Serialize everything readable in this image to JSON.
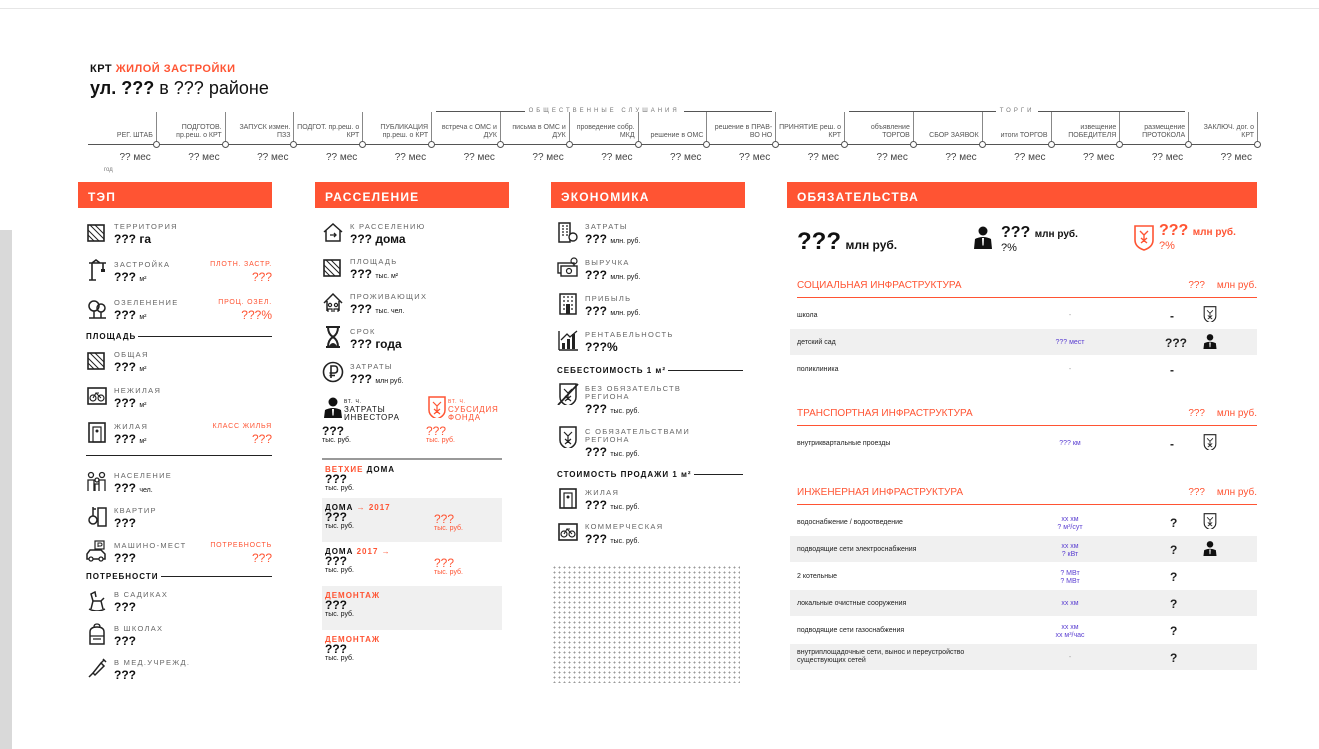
{
  "header": {
    "prefix": "КРТ",
    "title_red": "ЖИЛОЙ ЗАСТРОЙКИ",
    "street_bold": "ул. ???",
    "street_rest": "в ??? районе"
  },
  "timeline": {
    "groups": [
      {
        "label": "ОБЩЕСТВЕННЫЕ СЛУШАНИЯ"
      },
      {
        "label": "ТОРГИ"
      }
    ],
    "stages": [
      {
        "label": "РЕГ. ШТАБ",
        "mes": "?? мес"
      },
      {
        "label": "ПОДГОТОВ. пр.реш. о КРТ",
        "mes": "?? мес"
      },
      {
        "label": "ЗАПУСК измен. ПЗЗ",
        "mes": "?? мес"
      },
      {
        "label": "ПОДГОТ. пр.реш. о КРТ",
        "mes": "?? мес"
      },
      {
        "label": "ПУБЛИКАЦИЯ пр.реш. о КРТ",
        "mes": "?? мес"
      },
      {
        "label": "встреча с ОМС и ДУК",
        "mes": "?? мес"
      },
      {
        "label": "письма в ОМС и ДУК",
        "mes": "?? мес"
      },
      {
        "label": "проведение собр. МКД",
        "mes": "?? мес"
      },
      {
        "label": "решение в ОМС",
        "mes": "?? мес"
      },
      {
        "label": "решение в ПРАВ-ВО НО",
        "mes": "?? мес"
      },
      {
        "label": "ПРИНЯТИЕ реш. о КРТ",
        "mes": "?? мес"
      },
      {
        "label": "объявление ТОРГОВ",
        "mes": "?? мес"
      },
      {
        "label": "СБОР ЗАЯВОК",
        "mes": "?? мес"
      },
      {
        "label": "итоги ТОРГОВ",
        "mes": "?? мес"
      },
      {
        "label": "извещение ПОБЕДИТЕЛЯ",
        "mes": "?? мес"
      },
      {
        "label": "размещение ПРОТОКОЛА",
        "mes": "?? мес"
      },
      {
        "label": "ЗАКЛЮЧ. дог. о КРТ",
        "mes": "?? мес"
      }
    ],
    "first_sub": "год"
  },
  "tep": {
    "title": "ТЭП",
    "items": [
      {
        "label": "ТЕРРИТОРИЯ",
        "value": "??? га",
        "unit": "",
        "icon": "territory-icon"
      },
      {
        "label": "ЗАСТРОЙКА",
        "value": "???",
        "unit": "м²",
        "icon": "crane-icon",
        "right_label": "ПЛОТН. ЗАСТР.",
        "right_value": "???"
      },
      {
        "label": "ОЗЕЛЕНЕНИЕ",
        "value": "???",
        "unit": "м²",
        "icon": "tree-icon",
        "right_label": "ПРОЦ. ОЗЕЛ.",
        "right_value": "???%"
      }
    ],
    "area_title": "ПЛОЩАДЬ",
    "area_items": [
      {
        "label": "ОБЩАЯ",
        "value": "???",
        "unit": "м²",
        "icon": "area-icon"
      },
      {
        "label": "НЕЖИЛАЯ",
        "value": "???",
        "unit": "м²",
        "icon": "bike-icon"
      },
      {
        "label": "ЖИЛАЯ",
        "value": "???",
        "unit": "м²",
        "icon": "door-icon",
        "right_label": "КЛАСС ЖИЛЬЯ",
        "right_value": "???"
      }
    ],
    "pop_items": [
      {
        "label": "НАСЕЛЕНИЕ",
        "value": "???",
        "unit": "чел.",
        "icon": "family-icon"
      },
      {
        "label": "КВАРТИР",
        "value": "???",
        "unit": "",
        "icon": "keys-icon"
      },
      {
        "label": "МАШИНО-МЕСТ",
        "value": "???",
        "unit": "",
        "icon": "parking-icon",
        "right_label": "ПОТРЕБНОСТЬ",
        "right_value": "???"
      }
    ],
    "needs_title": "ПОТРЕБНОСТИ",
    "needs_items": [
      {
        "label": "В САДИКАХ",
        "value": "???",
        "icon": "rocking-horse-icon"
      },
      {
        "label": "В ШКОЛАХ",
        "value": "???",
        "icon": "backpack-icon"
      },
      {
        "label": "В МЕД.УЧРЕЖД.",
        "value": "???",
        "icon": "syringe-icon"
      }
    ]
  },
  "rass": {
    "title": "РАССЕЛЕНИЕ",
    "items": [
      {
        "label": "К РАССЕЛЕНИЮ",
        "value": "??? дома",
        "icon": "relocation-icon"
      },
      {
        "label": "ПЛОЩАДЬ",
        "value": "???",
        "unit": "тыс. м²",
        "icon": "area-icon"
      },
      {
        "label": "ПРОЖИВАЮЩИХ",
        "value": "???",
        "unit": "тыс. чел.",
        "icon": "residents-icon"
      },
      {
        "label": "СРОК",
        "value": "??? года",
        "icon": "hourglass-icon"
      },
      {
        "label": "ЗАТРАТЫ",
        "value": "???",
        "unit": "млн руб.",
        "icon": "ruble-icon"
      }
    ],
    "inv_label_small": "ВТ. Ч.",
    "inv_label": "ЗАТРАТЫ ИНВЕСТОРА",
    "inv_value": "???",
    "inv_unit": "тыс. руб.",
    "fund_label_small": "ВТ. Ч.",
    "fund_label": "СУБСИДИЯ ФОНДА",
    "fund_value": "???",
    "fund_unit": "тыс. руб.",
    "blocks": [
      {
        "t1": "ВЕТХИЕ",
        "t2": " ДОМА",
        "v": "???",
        "u": "тыс. руб.",
        "gray": false
      },
      {
        "t1": "ДОМА",
        "t2": " → 2017",
        "v": "???",
        "u": "тыс. руб.",
        "rv": "???",
        "ru": "тыс. руб.",
        "gray": true
      },
      {
        "t1": "ДОМА",
        "t2": " 2017 →",
        "v": "???",
        "u": "тыс. руб.",
        "rv": "???",
        "ru": "тыс. руб.",
        "gray": false
      },
      {
        "t1": "ДЕМОНТАЖ",
        "t2": "",
        "v": "???",
        "u": "тыс. руб.",
        "gray": true
      },
      {
        "t1": "ДЕМОНТАЖ",
        "t2": "",
        "v": "???",
        "u": "тыс. руб.",
        "gray": false
      }
    ]
  },
  "econ": {
    "title": "ЭКОНОМИКА",
    "items": [
      {
        "label": "ЗАТРАТЫ",
        "value": "???",
        "unit": "млн. руб.",
        "icon": "building-cost-icon"
      },
      {
        "label": "ВЫРУЧКА",
        "value": "???",
        "unit": "млн. руб.",
        "icon": "money-icon"
      },
      {
        "label": "ПРИБЫЛЬ",
        "value": "???",
        "unit": "млн. руб.",
        "icon": "building-profit-icon"
      },
      {
        "label": "РЕНТАБЕЛЬНОСТЬ",
        "value": "???%",
        "unit": "",
        "icon": "growth-chart-icon"
      }
    ],
    "cost_title": "СЕБЕСТОИМОСТЬ 1 м²",
    "cost_items": [
      {
        "label": "БЕЗ ОБЯЗАТЕЛЬСТВ РЕГИОНА",
        "value": "???",
        "unit": "тыс. руб.",
        "icon": "no-region-icon"
      },
      {
        "label": "С ОБЯЗАТЕЛЬСТВАМИ РЕГИОНА",
        "value": "???",
        "unit": "тыс. руб.",
        "icon": "region-icon"
      }
    ],
    "sale_title": "СТОИМОСТЬ ПРОДАЖИ 1 м²",
    "sale_items": [
      {
        "label": "ЖИЛАЯ",
        "value": "???",
        "unit": "тыс. руб.",
        "icon": "door-icon"
      },
      {
        "label": "КОММЕРЧЕСКАЯ",
        "value": "???",
        "unit": "тыс. руб.",
        "icon": "bike-icon"
      }
    ]
  },
  "obl": {
    "title": "ОБЯЗАТЕЛЬСТВА",
    "total_value": "???",
    "total_unit": "млн руб.",
    "inv_value": "???",
    "inv_unit": "млн руб.",
    "inv_pct": "?%",
    "reg_value": "???",
    "reg_unit": "млн руб.",
    "reg_pct": "?%",
    "sections": [
      {
        "title": "СОЦИАЛЬНАЯ ИНФРАСТРУКТУРА",
        "a": "???",
        "b": "млн руб.",
        "rows": [
          {
            "n": "школа",
            "m": "-",
            "q": "-",
            "ic": "region"
          },
          {
            "n": "детский сад",
            "m": "??? мест",
            "q": "???",
            "ic": "investor"
          },
          {
            "n": "поликлиника",
            "m": "-",
            "q": "-",
            "ic": ""
          }
        ]
      },
      {
        "title": "ТРАНСПОРТНАЯ ИНФРАСТРУКТУРА",
        "a": "???",
        "b": "млн руб.",
        "rows": [
          {
            "n": "внутриквартальные проезды",
            "m": "??? км",
            "q": "-",
            "ic": "region"
          }
        ]
      },
      {
        "title": "ИНЖЕНЕРНАЯ ИНФРАСТРУКТУРА",
        "a": "???",
        "b": "млн руб.",
        "rows": [
          {
            "n": "водоснабжение / водоотведение",
            "m": "хх хм\n? м³/сут",
            "q": "?",
            "ic": "region"
          },
          {
            "n": "подводящие сети электроснабжения",
            "m": "хх хм\n? кВт",
            "q": "?",
            "ic": "investor"
          },
          {
            "n": "2 котельные",
            "m": "? МВт\n? МВт",
            "q": "?",
            "ic": ""
          },
          {
            "n": "локальные очистные сооружения",
            "m": "хх хм",
            "q": "?",
            "ic": ""
          },
          {
            "n": "подводящие сети газоснабжения",
            "m": "хх хм\nхх м³/час",
            "q": "?",
            "ic": ""
          },
          {
            "n": "внутриплощадочные сети, вынос и переустройство\nсуществующих сетей",
            "m": "-",
            "q": "?",
            "ic": ""
          }
        ]
      }
    ]
  },
  "colors": {
    "accent": "#ff5433",
    "violet": "#5a3ed1"
  }
}
